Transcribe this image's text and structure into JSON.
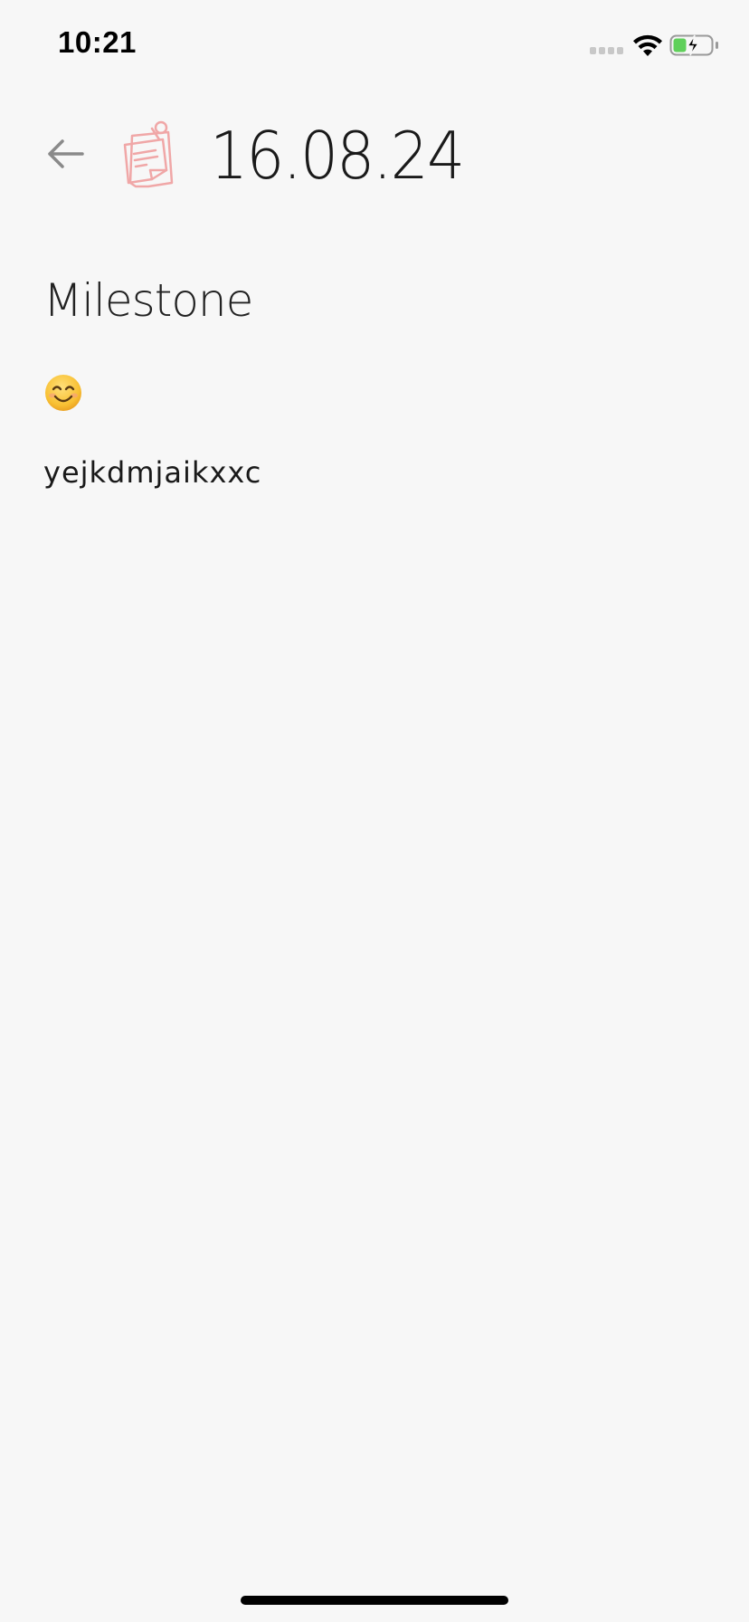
{
  "status_bar": {
    "time": "10:21",
    "icons": [
      "signal-dots-icon",
      "wifi-icon",
      "battery-charging-icon"
    ],
    "battery_color": "#5fd05a"
  },
  "header": {
    "back_icon": "arrow-left-icon",
    "note_icon": "pinned-note-icon",
    "note_icon_color": "#f0a7a7",
    "title": "16.08.24"
  },
  "entry": {
    "heading": "Milestone",
    "mood_icon": "smiling-face-icon",
    "text": "yejkdmjaikxxc"
  }
}
